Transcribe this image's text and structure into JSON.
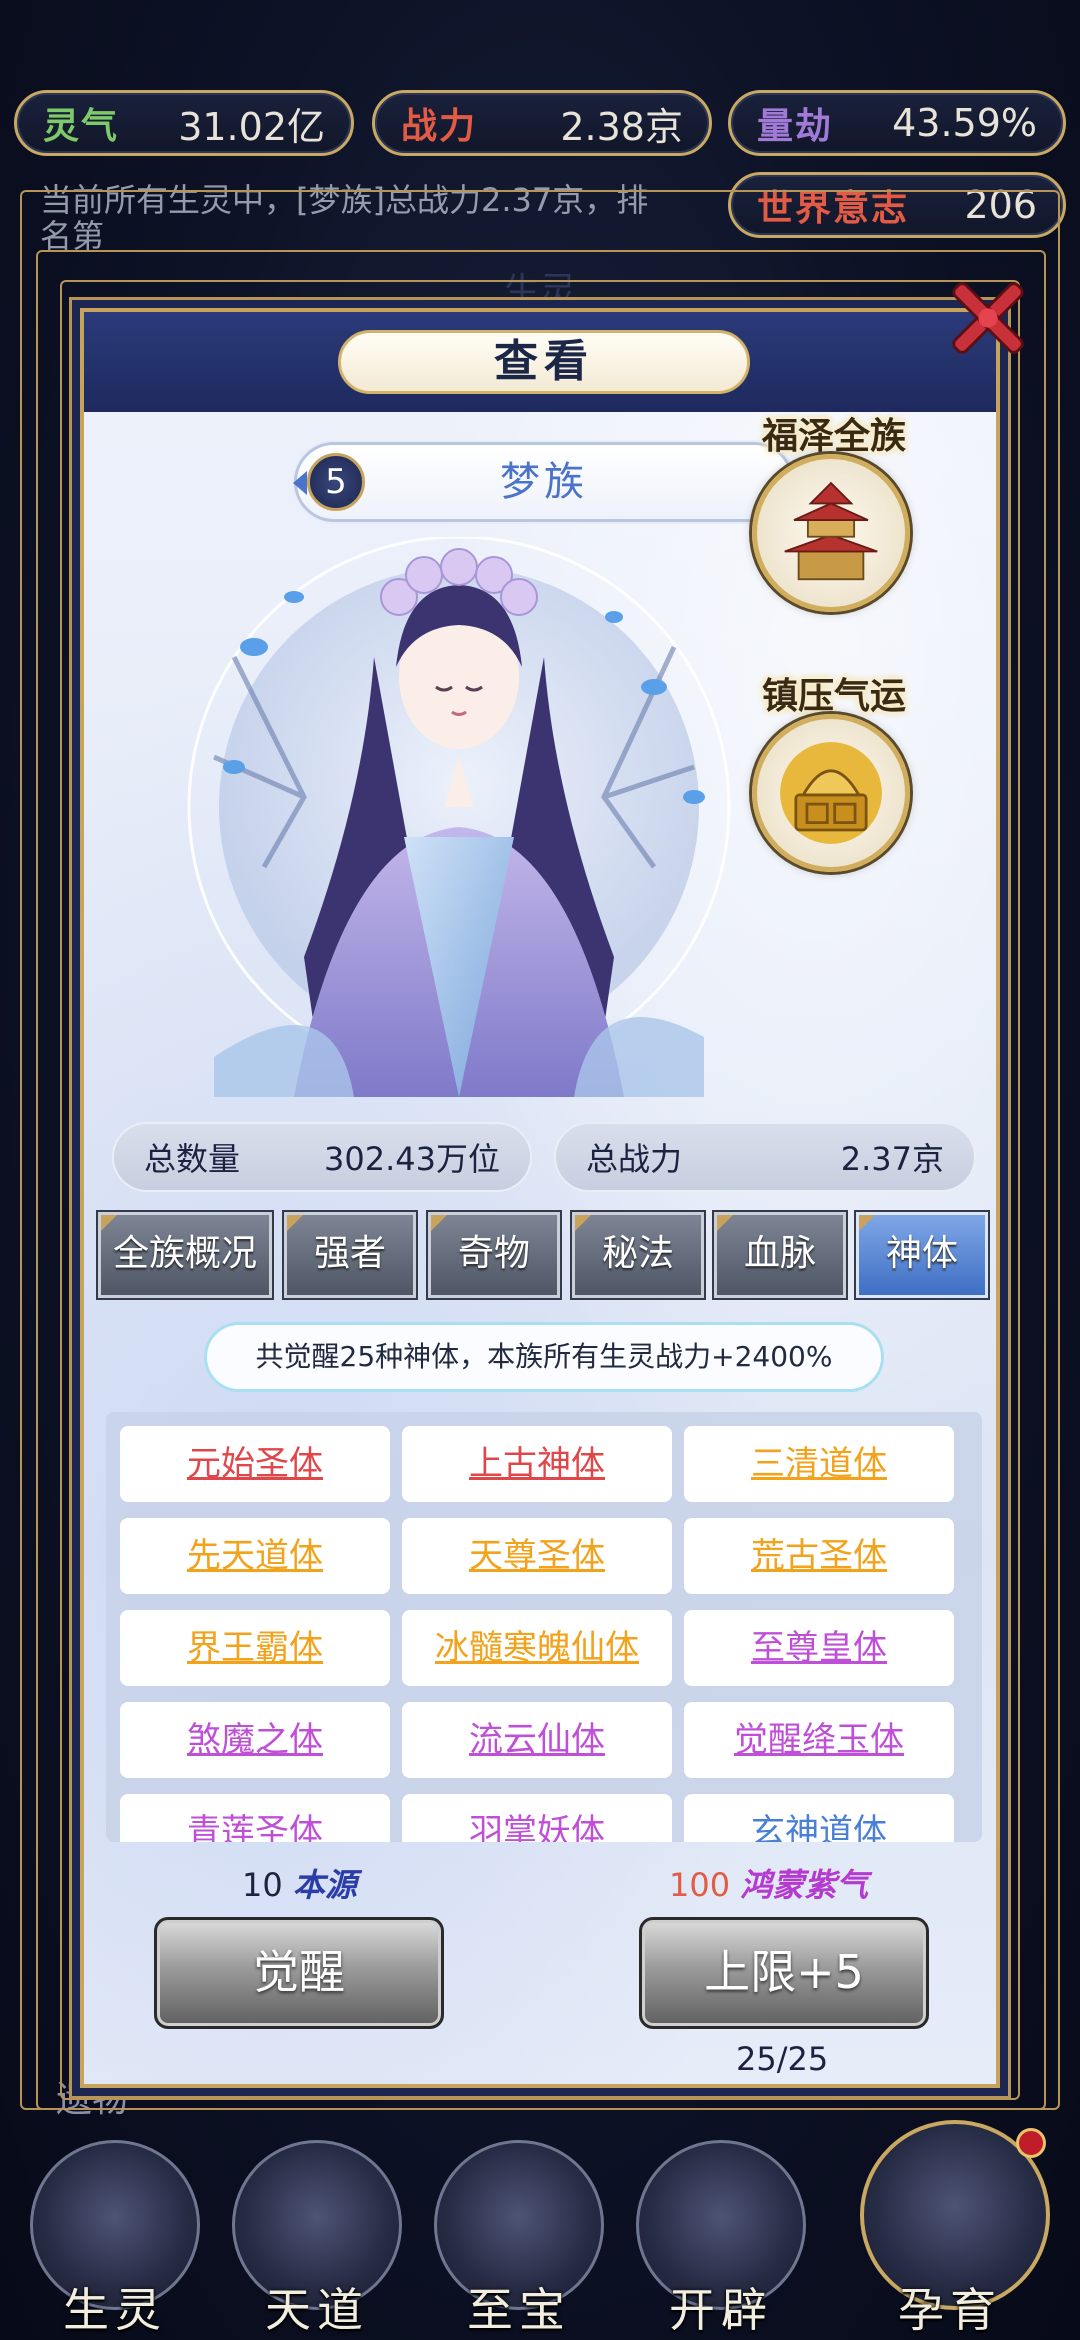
{
  "resources": [
    {
      "label": "灵气",
      "value": "31.02亿",
      "label_color": "#7ec96a"
    },
    {
      "label": "战力",
      "value": "2.38京",
      "label_color": "#e25b45"
    },
    {
      "label": "量劫",
      "value": "43.59%",
      "label_color": "#a07ad6"
    },
    {
      "label": "世界意志",
      "value": "206",
      "label_color": "#e25b45"
    }
  ],
  "background": {
    "notice": "当前所有生灵中，[梦族]总战力2.37京，排名第",
    "panel_tab": "生灵",
    "bottom_text": "遗物"
  },
  "modal": {
    "title": "查看",
    "race": {
      "number": "5",
      "name": "梦族"
    },
    "buffs": [
      {
        "label": "福泽全族",
        "icon": "pavilion-icon"
      },
      {
        "label": "镇压气运",
        "icon": "golden-seal-icon"
      }
    ],
    "stats": [
      {
        "label": "总数量",
        "value": "302.43万位"
      },
      {
        "label": "总战力",
        "value": "2.37京"
      }
    ],
    "tabs": [
      "全族概况",
      "强者",
      "奇物",
      "秘法",
      "血脉",
      "神体"
    ],
    "active_tab": "神体",
    "info": "共觉醒25种神体，本族所有生灵战力+2400%",
    "bodies": [
      {
        "name": "元始圣体",
        "color": "#e0474a"
      },
      {
        "name": "上古神体",
        "color": "#e0474a"
      },
      {
        "name": "三清道体",
        "color": "#f2a21b"
      },
      {
        "name": "先天道体",
        "color": "#f2a21b"
      },
      {
        "name": "天尊圣体",
        "color": "#f2a21b"
      },
      {
        "name": "荒古圣体",
        "color": "#f2a21b"
      },
      {
        "name": "界王霸体",
        "color": "#f2a21b"
      },
      {
        "name": "冰髓寒魄仙体",
        "color": "#f2a21b"
      },
      {
        "name": "至尊皇体",
        "color": "#c04fd8"
      },
      {
        "name": "煞魔之体",
        "color": "#c04fd8"
      },
      {
        "name": "流云仙体",
        "color": "#c04fd8"
      },
      {
        "name": "觉醒绛玉体",
        "color": "#c04fd8"
      },
      {
        "name": "青莲圣体",
        "color": "#c04fd8"
      },
      {
        "name": "羽掌妖体",
        "color": "#c04fd8"
      },
      {
        "name": "玄神道体",
        "color": "#4a7fd6"
      }
    ],
    "awaken": {
      "cost_amount": "10",
      "cost_name": "本源",
      "button": "觉醒"
    },
    "limit": {
      "cost_amount": "100",
      "cost_name": "鸿蒙紫气",
      "button": "上限+5",
      "count": "25/25"
    }
  },
  "nav": [
    "生灵",
    "天道",
    "至宝",
    "开辟",
    "孕育"
  ],
  "colors": {
    "gold": "#c9a861",
    "navy": "#1e2a5e",
    "accent_blue": "#4a73c9"
  }
}
